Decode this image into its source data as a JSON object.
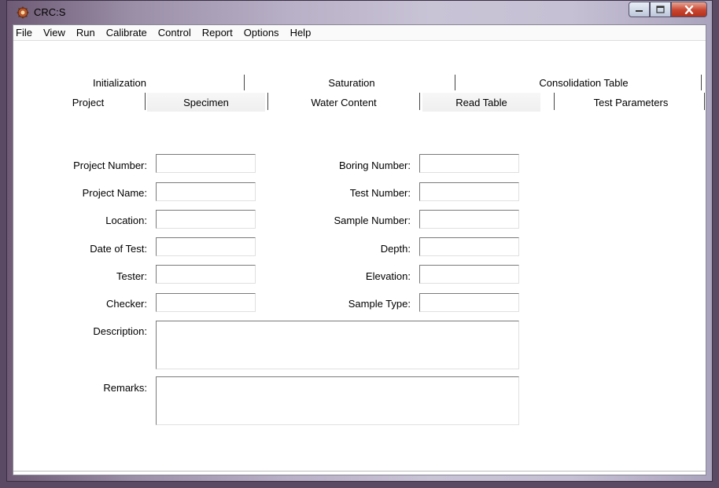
{
  "window": {
    "title": "CRC:S"
  },
  "menu": [
    "File",
    "View",
    "Run",
    "Calibrate",
    "Control",
    "Report",
    "Options",
    "Help"
  ],
  "tabs_row1": [
    "Initialization",
    "Saturation",
    "Consolidation Table"
  ],
  "tabs_row2": [
    "Project",
    "Specimen",
    "Water Content",
    "Read Table",
    "Test Parameters"
  ],
  "active_tab": "Project",
  "form": {
    "project_number": {
      "label": "Project Number:",
      "value": ""
    },
    "project_name": {
      "label": "Project Name:",
      "value": ""
    },
    "location": {
      "label": "Location:",
      "value": ""
    },
    "date_of_test": {
      "label": "Date of Test:",
      "value": ""
    },
    "tester": {
      "label": "Tester:",
      "value": ""
    },
    "checker": {
      "label": "Checker:",
      "value": ""
    },
    "boring_number": {
      "label": "Boring Number:",
      "value": ""
    },
    "test_number": {
      "label": "Test Number:",
      "value": ""
    },
    "sample_number": {
      "label": "Sample Number:",
      "value": ""
    },
    "depth": {
      "label": "Depth:",
      "value": ""
    },
    "elevation": {
      "label": "Elevation:",
      "value": ""
    },
    "sample_type": {
      "label": "Sample Type:",
      "value": ""
    },
    "description": {
      "label": "Description:",
      "value": ""
    },
    "remarks": {
      "label": "Remarks:",
      "value": ""
    }
  },
  "icons": {
    "app": "crc-app-icon",
    "minimize": "minimize-icon",
    "maximize": "maximize-icon",
    "close": "close-icon"
  },
  "colors": {
    "close_button": "#c8452f",
    "window_frame": "#9b8fa8"
  }
}
